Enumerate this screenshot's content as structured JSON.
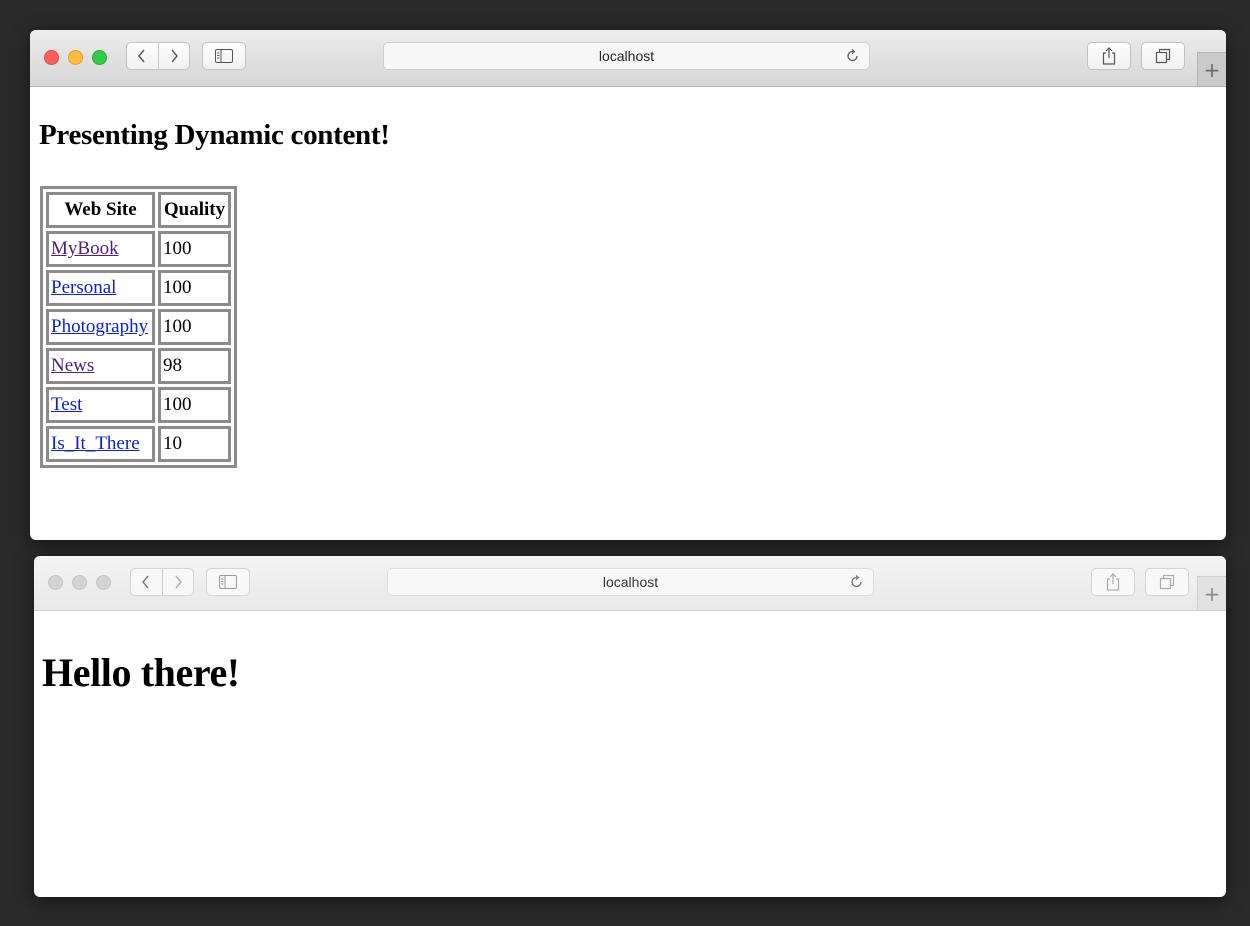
{
  "windows": [
    {
      "address": "localhost",
      "heading": "Presenting Dynamic content!",
      "table": {
        "headers": [
          "Web Site",
          "Quality"
        ],
        "rows": [
          {
            "site": "MyBook",
            "quality": "100",
            "visited": true
          },
          {
            "site": "Personal",
            "quality": "100",
            "visited": false
          },
          {
            "site": "Photography",
            "quality": "100",
            "visited": false
          },
          {
            "site": "News",
            "quality": "98",
            "visited": true
          },
          {
            "site": "Test",
            "quality": "100",
            "visited": false
          },
          {
            "site": "Is_It_There",
            "quality": "10",
            "visited": false
          }
        ]
      }
    },
    {
      "address": "localhost",
      "heading": "Hello there!"
    }
  ],
  "toolbar": {
    "new_tab_label": "+",
    "icons": [
      "back-icon",
      "forward-icon",
      "sidebar-icon",
      "reload-icon",
      "share-icon",
      "tabs-icon"
    ]
  },
  "colors": {
    "link": "#0b22c8",
    "visited_link": "#4b1d86",
    "table_border": "#8b8b8b",
    "traffic_red": "#fc605b",
    "traffic_yellow": "#fdbc40",
    "traffic_green": "#34c84a"
  }
}
